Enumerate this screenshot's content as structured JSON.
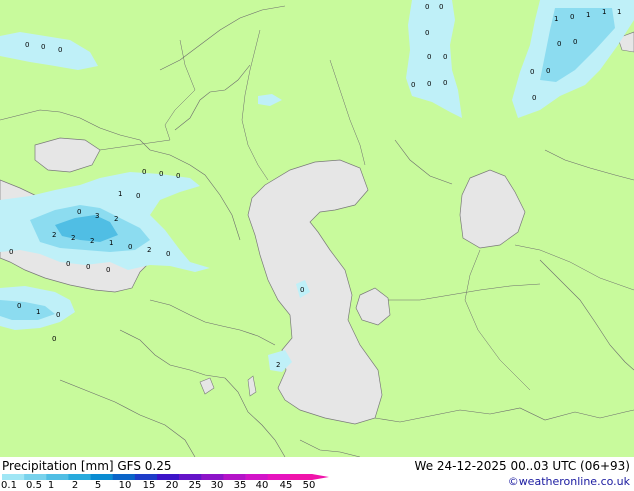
{
  "footer": {
    "title_left": "Precipitation [mm]  GFS 0.25",
    "title_right": "We 24-12-2025 00..03 UTC (06+93)",
    "credit": "©weatheronline.co.uk"
  },
  "legend": {
    "ticks": [
      "0.1",
      "0.5",
      "1",
      "2",
      "5",
      "10",
      "15",
      "20",
      "25",
      "30",
      "35",
      "40",
      "45",
      "50"
    ],
    "colors": [
      "#a0e6f5",
      "#78d2ec",
      "#50bee4",
      "#28aadc",
      "#0a8cd2",
      "#0a64c8",
      "#1e3cc8",
      "#3c14c8",
      "#6414c8",
      "#8c14c8",
      "#b414c8",
      "#d214c8",
      "#e614be",
      "#f014aa"
    ]
  },
  "map": {
    "land_color": "#c8fa9c",
    "sea_color": "#e6e6e6",
    "precip_light": "#bff0f8",
    "precip_mid": "#8cdcf0",
    "precip_high": "#50bee4",
    "values": [
      {
        "t": "0"
      },
      {
        "t": "0"
      },
      {
        "t": "0"
      },
      {
        "t": "0"
      },
      {
        "t": "0"
      },
      {
        "t": "0"
      },
      {
        "t": "0"
      },
      {
        "t": "0"
      },
      {
        "t": "0"
      },
      {
        "t": "0"
      },
      {
        "t": "0"
      },
      {
        "t": "1"
      },
      {
        "t": "0"
      },
      {
        "t": "1"
      },
      {
        "t": "1"
      },
      {
        "t": "1"
      },
      {
        "t": "0"
      },
      {
        "t": "0"
      },
      {
        "t": "0"
      },
      {
        "t": "0"
      },
      {
        "t": "0"
      },
      {
        "t": "0"
      },
      {
        "t": "0"
      },
      {
        "t": "0"
      },
      {
        "t": "1"
      },
      {
        "t": "0"
      },
      {
        "t": "0"
      },
      {
        "t": "3"
      },
      {
        "t": "2"
      },
      {
        "t": "2"
      },
      {
        "t": "2"
      },
      {
        "t": "2"
      },
      {
        "t": "1"
      },
      {
        "t": "0"
      },
      {
        "t": "2"
      },
      {
        "t": "0"
      },
      {
        "t": "0"
      },
      {
        "t": "0"
      },
      {
        "t": "0"
      },
      {
        "t": "0"
      },
      {
        "t": "0"
      },
      {
        "t": "1"
      },
      {
        "t": "0"
      },
      {
        "t": "0"
      },
      {
        "t": "0"
      },
      {
        "t": "2"
      }
    ]
  }
}
